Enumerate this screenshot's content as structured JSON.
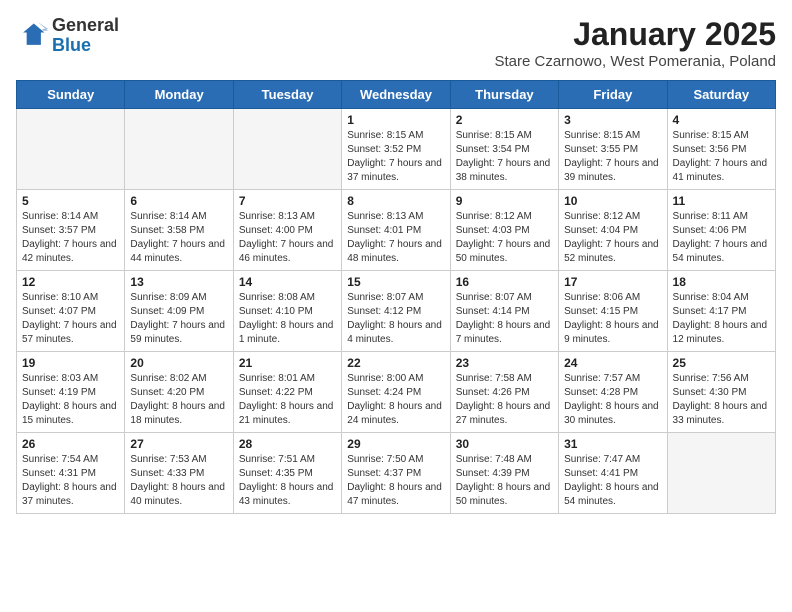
{
  "logo": {
    "general": "General",
    "blue": "Blue"
  },
  "title": "January 2025",
  "subtitle": "Stare Czarnowo, West Pomerania, Poland",
  "headers": [
    "Sunday",
    "Monday",
    "Tuesday",
    "Wednesday",
    "Thursday",
    "Friday",
    "Saturday"
  ],
  "weeks": [
    [
      {
        "day": "",
        "text": ""
      },
      {
        "day": "",
        "text": ""
      },
      {
        "day": "",
        "text": ""
      },
      {
        "day": "1",
        "text": "Sunrise: 8:15 AM\nSunset: 3:52 PM\nDaylight: 7 hours and 37 minutes."
      },
      {
        "day": "2",
        "text": "Sunrise: 8:15 AM\nSunset: 3:54 PM\nDaylight: 7 hours and 38 minutes."
      },
      {
        "day": "3",
        "text": "Sunrise: 8:15 AM\nSunset: 3:55 PM\nDaylight: 7 hours and 39 minutes."
      },
      {
        "day": "4",
        "text": "Sunrise: 8:15 AM\nSunset: 3:56 PM\nDaylight: 7 hours and 41 minutes."
      }
    ],
    [
      {
        "day": "5",
        "text": "Sunrise: 8:14 AM\nSunset: 3:57 PM\nDaylight: 7 hours and 42 minutes."
      },
      {
        "day": "6",
        "text": "Sunrise: 8:14 AM\nSunset: 3:58 PM\nDaylight: 7 hours and 44 minutes."
      },
      {
        "day": "7",
        "text": "Sunrise: 8:13 AM\nSunset: 4:00 PM\nDaylight: 7 hours and 46 minutes."
      },
      {
        "day": "8",
        "text": "Sunrise: 8:13 AM\nSunset: 4:01 PM\nDaylight: 7 hours and 48 minutes."
      },
      {
        "day": "9",
        "text": "Sunrise: 8:12 AM\nSunset: 4:03 PM\nDaylight: 7 hours and 50 minutes."
      },
      {
        "day": "10",
        "text": "Sunrise: 8:12 AM\nSunset: 4:04 PM\nDaylight: 7 hours and 52 minutes."
      },
      {
        "day": "11",
        "text": "Sunrise: 8:11 AM\nSunset: 4:06 PM\nDaylight: 7 hours and 54 minutes."
      }
    ],
    [
      {
        "day": "12",
        "text": "Sunrise: 8:10 AM\nSunset: 4:07 PM\nDaylight: 7 hours and 57 minutes."
      },
      {
        "day": "13",
        "text": "Sunrise: 8:09 AM\nSunset: 4:09 PM\nDaylight: 7 hours and 59 minutes."
      },
      {
        "day": "14",
        "text": "Sunrise: 8:08 AM\nSunset: 4:10 PM\nDaylight: 8 hours and 1 minute."
      },
      {
        "day": "15",
        "text": "Sunrise: 8:07 AM\nSunset: 4:12 PM\nDaylight: 8 hours and 4 minutes."
      },
      {
        "day": "16",
        "text": "Sunrise: 8:07 AM\nSunset: 4:14 PM\nDaylight: 8 hours and 7 minutes."
      },
      {
        "day": "17",
        "text": "Sunrise: 8:06 AM\nSunset: 4:15 PM\nDaylight: 8 hours and 9 minutes."
      },
      {
        "day": "18",
        "text": "Sunrise: 8:04 AM\nSunset: 4:17 PM\nDaylight: 8 hours and 12 minutes."
      }
    ],
    [
      {
        "day": "19",
        "text": "Sunrise: 8:03 AM\nSunset: 4:19 PM\nDaylight: 8 hours and 15 minutes."
      },
      {
        "day": "20",
        "text": "Sunrise: 8:02 AM\nSunset: 4:20 PM\nDaylight: 8 hours and 18 minutes."
      },
      {
        "day": "21",
        "text": "Sunrise: 8:01 AM\nSunset: 4:22 PM\nDaylight: 8 hours and 21 minutes."
      },
      {
        "day": "22",
        "text": "Sunrise: 8:00 AM\nSunset: 4:24 PM\nDaylight: 8 hours and 24 minutes."
      },
      {
        "day": "23",
        "text": "Sunrise: 7:58 AM\nSunset: 4:26 PM\nDaylight: 8 hours and 27 minutes."
      },
      {
        "day": "24",
        "text": "Sunrise: 7:57 AM\nSunset: 4:28 PM\nDaylight: 8 hours and 30 minutes."
      },
      {
        "day": "25",
        "text": "Sunrise: 7:56 AM\nSunset: 4:30 PM\nDaylight: 8 hours and 33 minutes."
      }
    ],
    [
      {
        "day": "26",
        "text": "Sunrise: 7:54 AM\nSunset: 4:31 PM\nDaylight: 8 hours and 37 minutes."
      },
      {
        "day": "27",
        "text": "Sunrise: 7:53 AM\nSunset: 4:33 PM\nDaylight: 8 hours and 40 minutes."
      },
      {
        "day": "28",
        "text": "Sunrise: 7:51 AM\nSunset: 4:35 PM\nDaylight: 8 hours and 43 minutes."
      },
      {
        "day": "29",
        "text": "Sunrise: 7:50 AM\nSunset: 4:37 PM\nDaylight: 8 hours and 47 minutes."
      },
      {
        "day": "30",
        "text": "Sunrise: 7:48 AM\nSunset: 4:39 PM\nDaylight: 8 hours and 50 minutes."
      },
      {
        "day": "31",
        "text": "Sunrise: 7:47 AM\nSunset: 4:41 PM\nDaylight: 8 hours and 54 minutes."
      },
      {
        "day": "",
        "text": ""
      }
    ]
  ]
}
